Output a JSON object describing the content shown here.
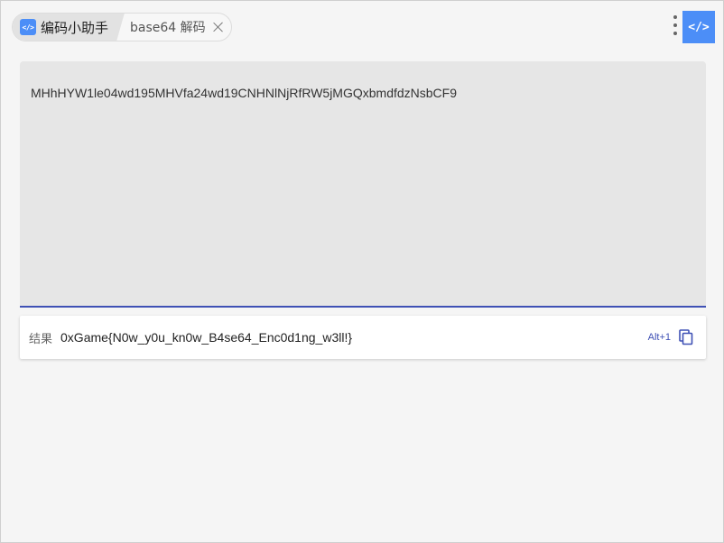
{
  "header": {
    "app_name": "编码小助手",
    "app_icon_glyph": "</>",
    "tool_name": "base64 解码",
    "action_button_glyph": "</>",
    "accent_color": "#4c8ef7"
  },
  "input": {
    "value": "MHhHYW1le04wd195MHVfa24wd19CNHNlNjRfRW5jMGQxbmdfdzNsbCF9"
  },
  "result": {
    "label": "结果",
    "value": "0xGame{N0w_y0u_kn0w_B4se64_Enc0d1ng_w3ll!}",
    "shortcut": "Alt+1",
    "underline_color": "#3f51b5"
  }
}
